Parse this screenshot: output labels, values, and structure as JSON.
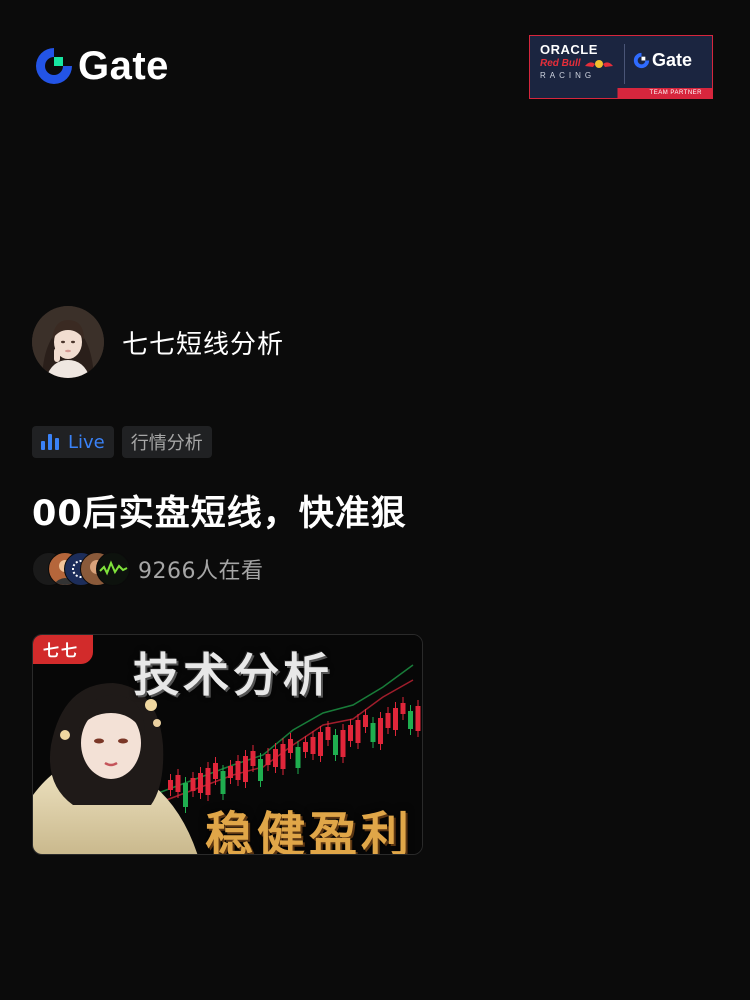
{
  "header": {
    "brand_name": "Gate",
    "partner": {
      "oracle_text": "ORACLE",
      "redbull_text": "Red Bull",
      "racing_text": "RACING",
      "gate_text": "Gate",
      "strip_text": "TEAM PARTNER"
    }
  },
  "streamer": {
    "name": "七七短线分析"
  },
  "tags": {
    "live_label": "Live",
    "category_label": "行情分析"
  },
  "stream": {
    "title": "00后实盘短线，快准狠",
    "viewer_count": "9266人在看"
  },
  "cover": {
    "badge": "七七",
    "headline": "技术分析",
    "subline": "稳健盈利"
  },
  "colors": {
    "background": "#0b0b0b",
    "live_accent": "#3a82f7",
    "brand_blue": "#2354e6",
    "brand_green": "#17e6a1",
    "tag_background": "#202123",
    "muted_text": "#a6a6a6",
    "candle_up": "#e0263a",
    "candle_down": "#1fae4f"
  },
  "icons": {
    "brand": "gate-logo-icon",
    "live": "live-bars-icon"
  }
}
